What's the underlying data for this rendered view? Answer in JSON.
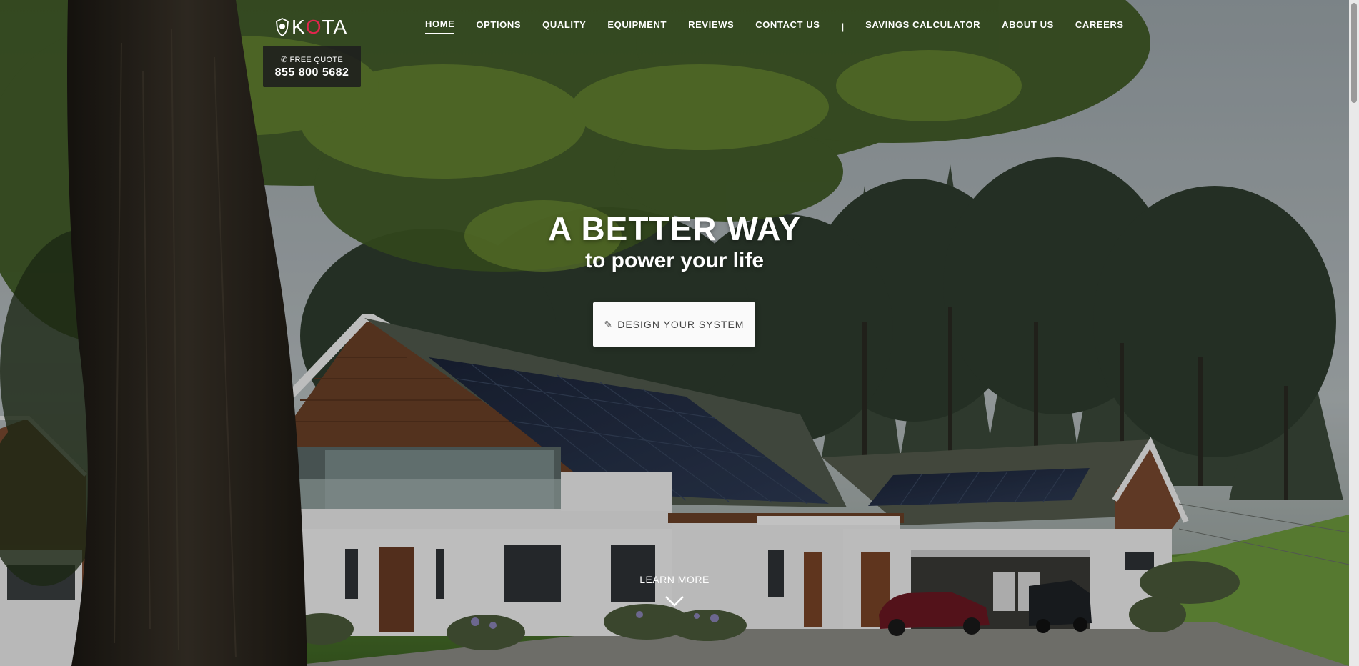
{
  "brand": {
    "logo_prefix": "K",
    "logo_o": "O",
    "logo_suffix": "TA",
    "accent": "#e2264d"
  },
  "quote": {
    "icon": "phone-icon",
    "label": "FREE QUOTE",
    "phone": "855 800 5682"
  },
  "nav": {
    "items": [
      {
        "label": "HOME",
        "active": true
      },
      {
        "label": "OPTIONS"
      },
      {
        "label": "QUALITY"
      },
      {
        "label": "EQUIPMENT"
      },
      {
        "label": "REVIEWS"
      },
      {
        "label": "CONTACT US"
      },
      {
        "label": "|"
      },
      {
        "label": "SAVINGS CALCULATOR"
      },
      {
        "label": "ABOUT US"
      },
      {
        "label": "CAREERS"
      }
    ]
  },
  "hero": {
    "title": "A BETTER WAY",
    "subtitle": "to power your life",
    "cta_icon": "pencil-icon",
    "cta_label": "DESIGN YOUR SYSTEM",
    "learn_more": "LEARN MORE",
    "learn_icon": "chevron-down-icon"
  }
}
